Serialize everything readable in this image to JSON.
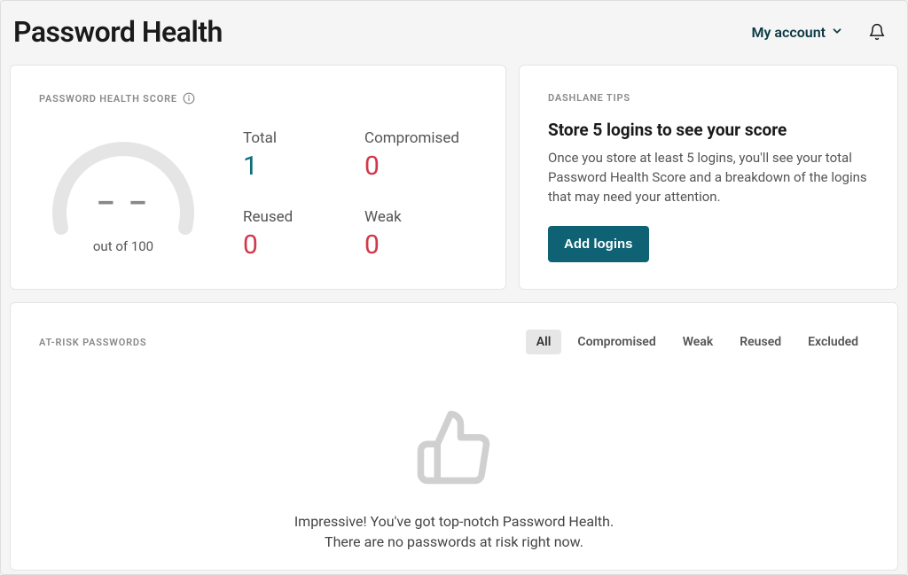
{
  "header": {
    "title": "Password Health",
    "account_label": "My account"
  },
  "score": {
    "label": "PASSWORD HEALTH SCORE",
    "value_display": "– –",
    "sub": "out of 100",
    "stats": {
      "total": {
        "label": "Total",
        "value": "1"
      },
      "compromised": {
        "label": "Compromised",
        "value": "0"
      },
      "reused": {
        "label": "Reused",
        "value": "0"
      },
      "weak": {
        "label": "Weak",
        "value": "0"
      }
    }
  },
  "tips": {
    "label": "DASHLANE TIPS",
    "title": "Store 5 logins to see your score",
    "body": "Once you store at least 5 logins, you'll see your total Password Health Score and a breakdown of the logins that may need your attention.",
    "button": "Add logins"
  },
  "risk": {
    "label": "AT-RISK PASSWORDS",
    "tabs": [
      "All",
      "Compromised",
      "Weak",
      "Reused",
      "Excluded"
    ],
    "active_tab": "All",
    "empty_line1": "Impressive! You've got top-notch Password Health.",
    "empty_line2": "There are no passwords at risk right now."
  }
}
